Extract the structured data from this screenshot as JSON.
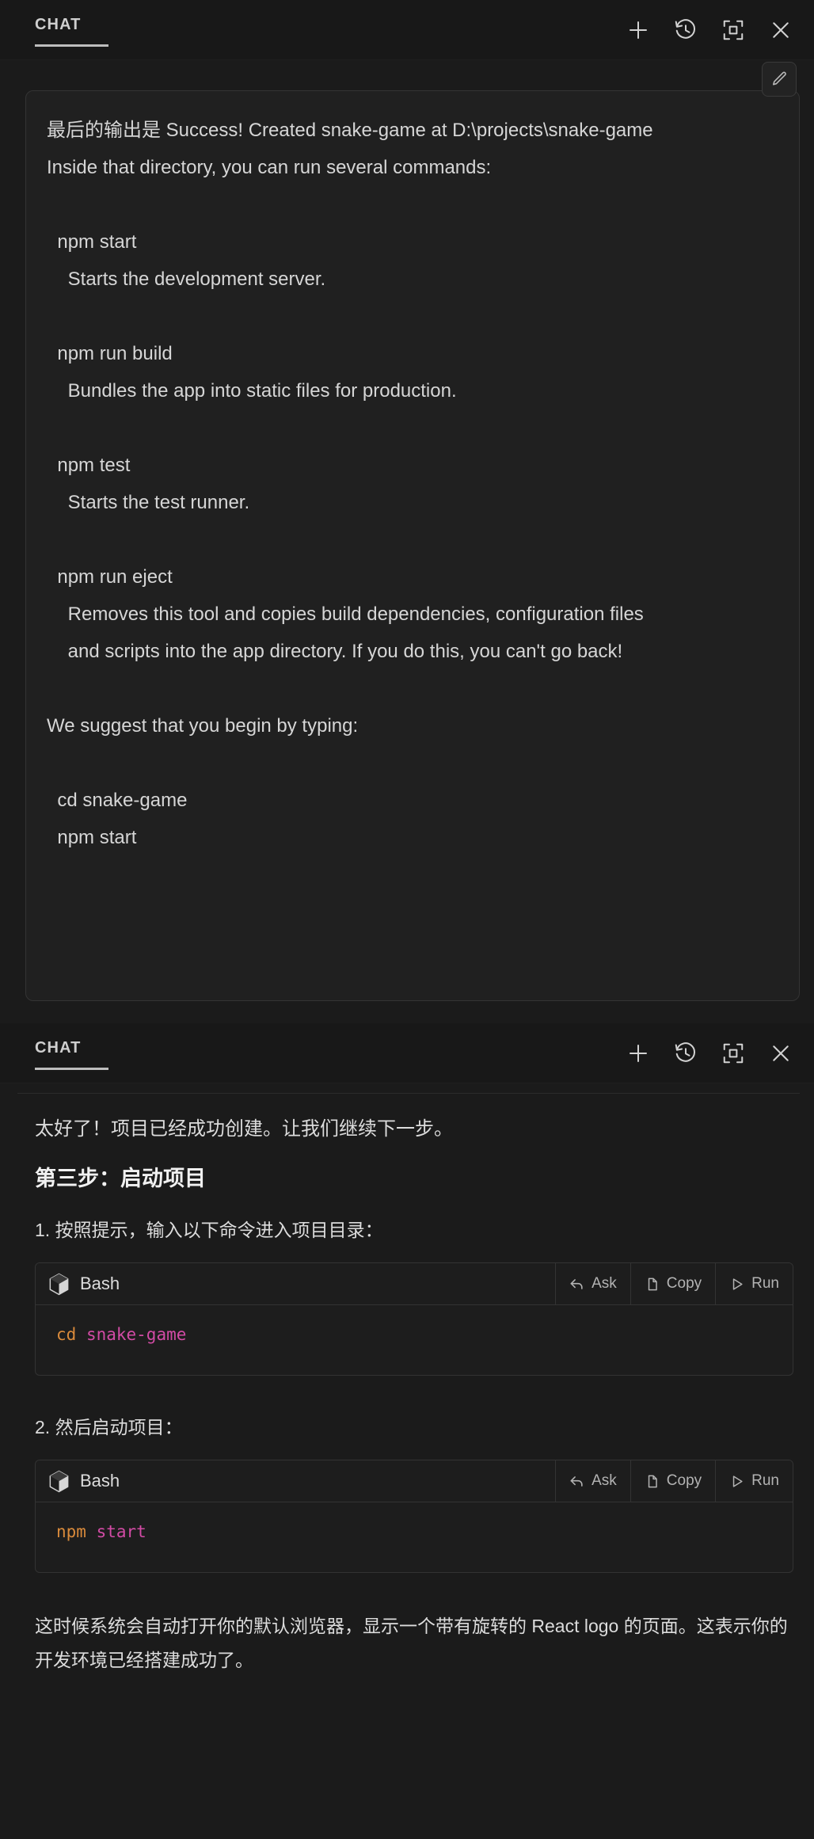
{
  "panels": {
    "top": {
      "title": "CHAT",
      "actions": [
        {
          "name": "new-chat-icon",
          "label": "New Chat"
        },
        {
          "name": "history-icon",
          "label": "History"
        },
        {
          "name": "maximize-icon",
          "label": "Maximize"
        },
        {
          "name": "close-icon",
          "label": "Close"
        }
      ]
    },
    "bottom": {
      "title": "CHAT",
      "actions": [
        {
          "name": "new-chat-icon",
          "label": "New Chat"
        },
        {
          "name": "history-icon",
          "label": "History"
        },
        {
          "name": "maximize-icon",
          "label": "Maximize"
        },
        {
          "name": "close-icon",
          "label": "Close"
        }
      ]
    }
  },
  "user_message": {
    "edit_button_label": "Edit",
    "body": "最后的输出是 Success! Created snake-game at D:\\projects\\snake-game\nInside that directory, you can run several commands:\n\n  npm start\n    Starts the development server.\n\n  npm run build\n    Bundles the app into static files for production.\n\n  npm test\n    Starts the test runner.\n\n  npm run eject\n    Removes this tool and copies build dependencies, configuration files\n    and scripts into the app directory. If you do this, you can't go back!\n\nWe suggest that you begin by typing:\n\n  cd snake-game\n  npm start"
  },
  "assistant_message": {
    "intro": "太好了！项目已经成功创建。让我们继续下一步。",
    "heading": "第三步：启动项目",
    "step1_label": "1. 按照提示，输入以下命令进入项目目录：",
    "step2_label": "2. 然后启动项目：",
    "closing": "这时候系统会自动打开你的默认浏览器，显示一个带有旋转的 React logo 的页面。这表示你的开发环境已经搭建成功了。",
    "code_blocks": [
      {
        "language": "Bash",
        "buttons": {
          "ask": "Ask",
          "copy": "Copy",
          "run": "Run"
        },
        "command": "cd",
        "argument": "snake-game"
      },
      {
        "language": "Bash",
        "buttons": {
          "ask": "Ask",
          "copy": "Copy",
          "run": "Run"
        },
        "command": "npm",
        "argument": "start"
      }
    ]
  },
  "colors": {
    "background": "#1b1b1b",
    "header_background": "#181818",
    "bubble_background": "#202020",
    "bubble_border": "#343434",
    "code_background": "#1d1d1d",
    "code_border": "#333333",
    "text_primary": "#d6d6d6",
    "heading": "#f1f1f1",
    "token_command": "#d98a3b",
    "token_argument": "#d24ba5",
    "tab_underline": "#bdbdbd"
  }
}
